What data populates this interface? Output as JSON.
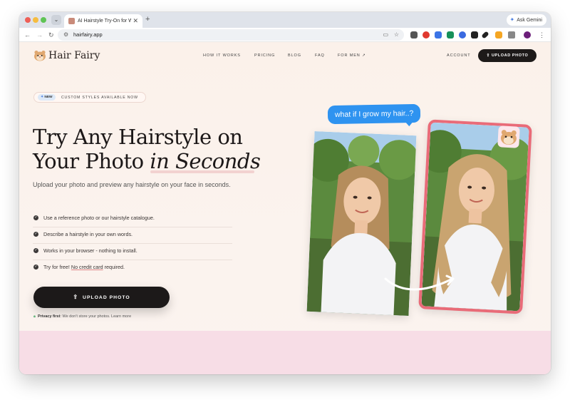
{
  "browser": {
    "tab_title": "AI Hairstyle Try-On for Women",
    "url": "hairfairy.app",
    "ask_gemini": "Ask Gemini",
    "traffic_lights": [
      "#ee5f57",
      "#f6bd40",
      "#5fc455"
    ],
    "extensions": [
      {
        "name": "cookie-extension",
        "color": "#555"
      },
      {
        "name": "opera-extension",
        "color": "#e0392f"
      },
      {
        "name": "translate-extension",
        "color": "#3b74e6"
      },
      {
        "name": "sheet-extension",
        "color": "#17915a"
      },
      {
        "name": "bolt-extension",
        "color": "#3a6ae0"
      },
      {
        "name": "notion-extension",
        "color": "#222"
      },
      {
        "name": "pen-extension",
        "color": "#222"
      },
      {
        "name": "badge-extension",
        "color": "#f5a623"
      },
      {
        "name": "puzzle-extension",
        "color": "#666"
      },
      {
        "name": "profile-avatar",
        "color": "#6c1e7a"
      }
    ]
  },
  "site": {
    "brand": "Hair Fairy",
    "nav": [
      "HOW IT WORKS",
      "PRICING",
      "BLOG",
      "FAQ",
      "FOR MEN"
    ],
    "account": "ACCOUNT",
    "top_cta": "UPLOAD PHOTO",
    "badge_new": "NEW",
    "badge_text": "CUSTOM STYLES AVAILABLE NOW",
    "headline_line1": "Try Any Hairstyle on",
    "headline_line2_a": "Your Photo ",
    "headline_line2_b": "in Seconds",
    "subheading": "Upload your photo and preview any hairstyle on your face in seconds.",
    "features": [
      {
        "text": "Use a reference photo or our hairstyle catalogue."
      },
      {
        "text": "Describe a hairstyle in your own words."
      },
      {
        "text": "Works in your browser - nothing to install."
      },
      {
        "text_a": "Try for free! ",
        "text_b": "No credit card",
        "text_c": " required."
      }
    ],
    "cta": "UPLOAD PHOTO",
    "privacy_bold": "Privacy first",
    "privacy_text": ": We don't store your photos. Learn more",
    "speech_bubble": "what if I grow my hair..?",
    "accent_color": "#e96b78",
    "bubble_color": "#2e93f0"
  }
}
